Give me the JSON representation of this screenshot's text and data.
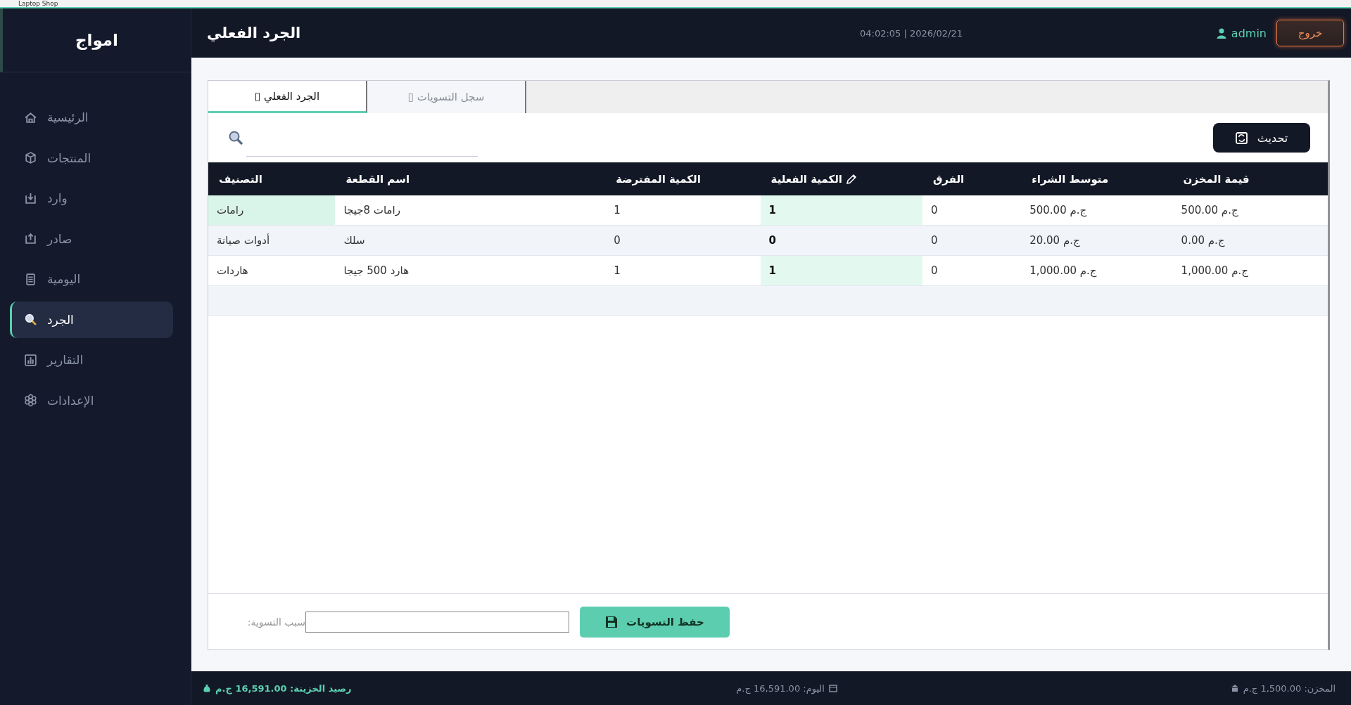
{
  "window": {
    "title": "Laptop Shop"
  },
  "sidebar": {
    "logo": "امواج",
    "items": [
      {
        "label": "الرئيسية",
        "selected": false
      },
      {
        "label": "المنتجات",
        "selected": false
      },
      {
        "label": "وارد",
        "selected": false
      },
      {
        "label": "صادر",
        "selected": false
      },
      {
        "label": "اليومية",
        "selected": false
      },
      {
        "label": "الجرد",
        "selected": true
      },
      {
        "label": "التقارير",
        "selected": false
      },
      {
        "label": "الإعدادات",
        "selected": false
      }
    ]
  },
  "header": {
    "title": "الجرد الفعلي",
    "datetime": "04:02:05 | 2026/02/21",
    "user": "admin",
    "logout": "خروج"
  },
  "tabs": [
    {
      "label": "سجل التسويات ▯",
      "selected": false
    },
    {
      "label": "الجرد الفعلي ▯",
      "selected": true
    }
  ],
  "refresh_button": "تحديث",
  "table": {
    "columns": [
      {
        "label": "قيمة المخزن",
        "editable": false
      },
      {
        "label": "متوسط الشراء",
        "editable": false
      },
      {
        "label": "الفرق",
        "editable": false
      },
      {
        "label": "الكمية الفعلية",
        "editable": true
      },
      {
        "label": "الكمية المفترضة",
        "editable": false
      },
      {
        "label": "اسم القطعة",
        "editable": false
      },
      {
        "label": "التصنيف",
        "editable": false
      }
    ],
    "rows": [
      {
        "cells": [
          "500.00 ج.م",
          "500.00 ج.م",
          "0",
          "1",
          "1",
          "رامات 8جيجا",
          "رامات"
        ],
        "category_selected": true,
        "actual_highlighted": true
      },
      {
        "cells": [
          "0.00 ج.م",
          "20.00 ج.م",
          "0",
          "0",
          "0",
          "سلك",
          "أدوات صيانة"
        ],
        "category_selected": false,
        "actual_highlighted": false
      },
      {
        "cells": [
          "1,000.00 ج.م",
          "1,000.00 ج.م",
          "0",
          "1",
          "1",
          "هارد 500 جيجا",
          "هاردات"
        ],
        "category_selected": false,
        "actual_highlighted": true
      }
    ]
  },
  "adjustment": {
    "label": "سبب التسوية:",
    "save_button": "حفظ التسويات"
  },
  "status_bar": {
    "treasury": "رصيد الخزينة: 16,591.00 ج.م",
    "today": "اليوم: 16,591.00 ج.م",
    "stock": "المخزن: 1,500.00 ج.م"
  }
}
